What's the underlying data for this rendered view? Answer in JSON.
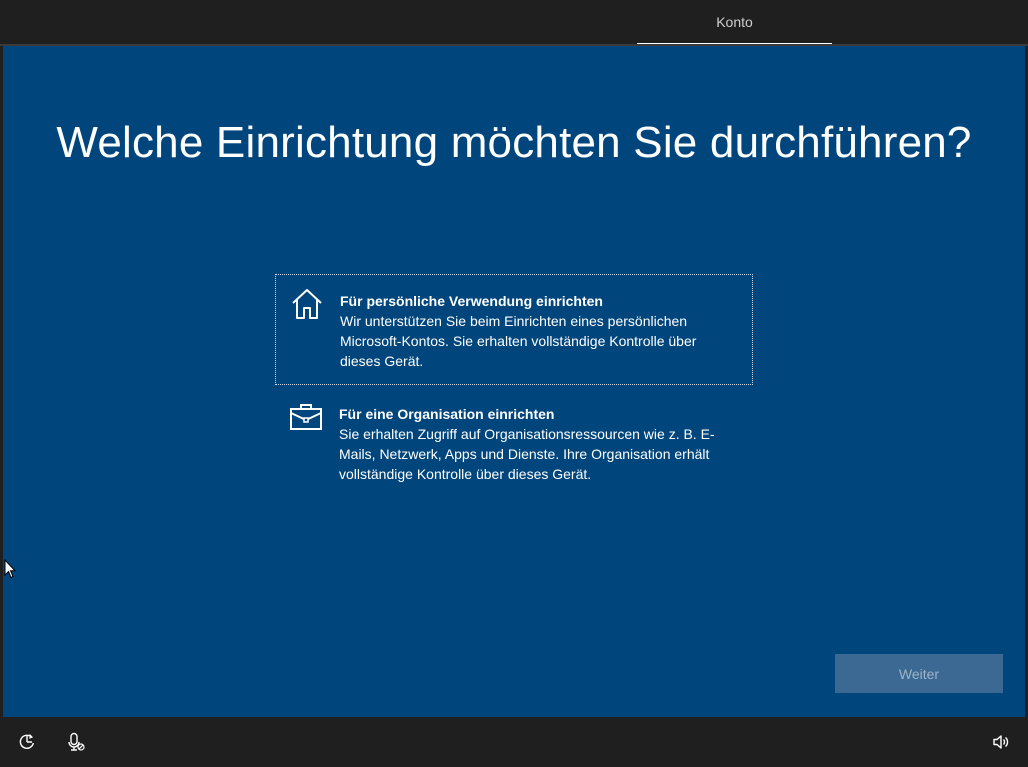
{
  "header": {
    "active_tab": "Konto"
  },
  "main": {
    "title": "Welche Einrichtung möchten Sie durchführen?",
    "options": [
      {
        "title": "Für persönliche Verwendung einrichten",
        "description": "Wir unterstützen Sie beim Einrichten eines persönlichen Microsoft-Kontos. Sie erhalten vollständige Kontrolle über dieses Gerät.",
        "icon": "home-icon",
        "selected": true
      },
      {
        "title": "Für eine Organisation einrichten",
        "description": "Sie erhalten Zugriff auf Organisationsressourcen wie z. B. E-Mails, Netzwerk, Apps und Dienste. Ihre Organisation erhält vollständige Kontrolle über dieses Gerät.",
        "icon": "briefcase-icon",
        "selected": false
      }
    ],
    "next_label": "Weiter"
  },
  "footer": {
    "icons": [
      "ease-of-access-icon",
      "microphone-icon",
      "volume-icon"
    ]
  },
  "colors": {
    "background": "#00457c",
    "chrome": "#1f1f1f",
    "button_disabled": "#3b6993"
  }
}
